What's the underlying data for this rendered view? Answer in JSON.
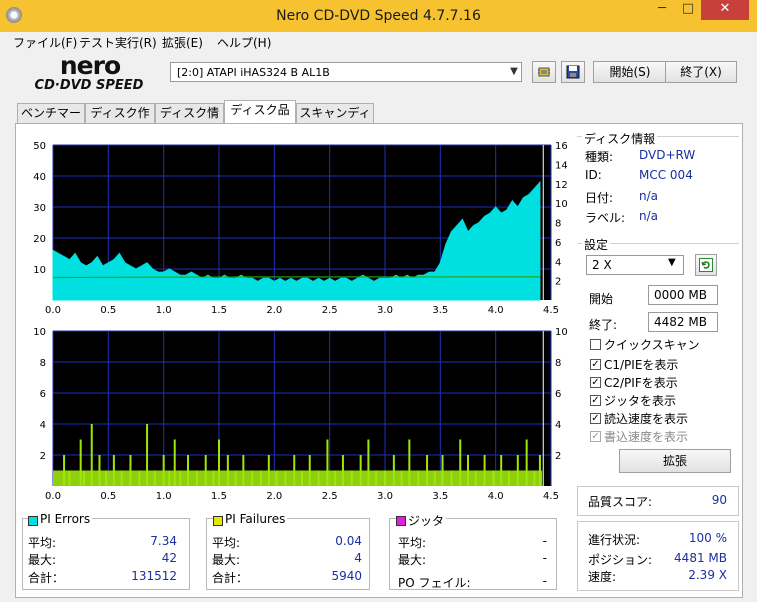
{
  "window": {
    "title": "Nero CD-DVD Speed 4.7.7.16",
    "minimize": "─",
    "maximize": "□",
    "close": "✕"
  },
  "menu": [
    "ファイル(F)",
    "テスト実行(R)",
    "拡張(E)",
    "ヘルプ(H)"
  ],
  "logo": {
    "top": "nero",
    "bottom": "CD·DVD SPEED"
  },
  "toolbar": {
    "drive": "[2:0]   ATAPI iHAS324   B AL1B",
    "start_label": "開始(S)",
    "exit_label": "終了(X)",
    "options_icon": "chip-icon",
    "save_icon": "floppy-disk-icon"
  },
  "tabs": [
    {
      "label": "ベンチマーク"
    },
    {
      "label": "ディスク作成"
    },
    {
      "label": "ディスク情報"
    },
    {
      "label": "ディスク品質",
      "active": true
    },
    {
      "label": "スキャンディスク"
    }
  ],
  "chart_data": [
    {
      "type": "area",
      "title": "PI Errors",
      "x": [
        0.0,
        0.05,
        0.1,
        0.15,
        0.2,
        0.25,
        0.3,
        0.35,
        0.4,
        0.45,
        0.5,
        0.55,
        0.6,
        0.65,
        0.7,
        0.75,
        0.8,
        0.85,
        0.9,
        0.95,
        1.0,
        1.05,
        1.1,
        1.15,
        1.2,
        1.25,
        1.3,
        1.35,
        1.4,
        1.45,
        1.5,
        1.55,
        1.6,
        1.65,
        1.7,
        1.75,
        1.8,
        1.85,
        1.9,
        1.95,
        2.0,
        2.05,
        2.1,
        2.15,
        2.2,
        2.25,
        2.3,
        2.35,
        2.4,
        2.45,
        2.5,
        2.55,
        2.6,
        2.65,
        2.7,
        2.75,
        2.8,
        2.85,
        2.9,
        2.95,
        3.0,
        3.05,
        3.1,
        3.15,
        3.2,
        3.25,
        3.3,
        3.35,
        3.4,
        3.45,
        3.5,
        3.55,
        3.6,
        3.65,
        3.7,
        3.75,
        3.8,
        3.85,
        3.9,
        3.95,
        4.0,
        4.05,
        4.1,
        4.15,
        4.2,
        4.25,
        4.3,
        4.35,
        4.4
      ],
      "series": [
        {
          "name": "PI Errors",
          "values": [
            16,
            15,
            14,
            13,
            15,
            12,
            11,
            12,
            14,
            11,
            12,
            13,
            15,
            12,
            11,
            10,
            11,
            12,
            10,
            9,
            9,
            10,
            9,
            8,
            8,
            9,
            8,
            7,
            8,
            7,
            7,
            8,
            7,
            7,
            8,
            7,
            7,
            6,
            7,
            7,
            6,
            7,
            6,
            7,
            6,
            7,
            7,
            6,
            7,
            6,
            7,
            6,
            7,
            7,
            6,
            7,
            8,
            7,
            6,
            7,
            7,
            7,
            8,
            7,
            8,
            7,
            8,
            8,
            9,
            9,
            12,
            18,
            22,
            24,
            26,
            22,
            24,
            25,
            27,
            28,
            30,
            28,
            29,
            32,
            30,
            33,
            34,
            36,
            38
          ]
        },
        {
          "name": "Read Speed",
          "values": [
            2.32,
            2.32,
            2.32,
            2.33,
            2.33,
            2.33,
            2.33,
            2.34,
            2.34,
            2.34,
            2.34,
            2.34,
            2.34,
            2.35,
            2.35,
            2.35,
            2.35,
            2.35,
            2.36,
            2.36,
            2.36,
            2.36,
            2.36,
            2.36,
            2.37,
            2.37,
            2.37,
            2.37,
            2.37,
            2.37,
            2.37,
            2.37,
            2.37,
            2.38,
            2.38,
            2.38,
            2.38,
            2.38,
            2.38,
            2.38,
            2.38,
            2.38,
            2.38,
            2.38,
            2.38,
            2.38,
            2.38,
            2.38,
            2.38,
            2.38,
            2.38,
            2.38,
            2.38,
            2.38,
            2.38,
            2.38,
            2.38,
            2.38,
            2.38,
            2.38,
            2.38,
            2.38,
            2.38,
            2.38,
            2.38,
            2.38,
            2.38,
            2.38,
            2.38,
            2.38,
            2.38,
            2.38,
            2.39,
            2.39,
            2.39,
            2.39,
            2.39,
            2.39,
            2.39,
            2.39,
            2.39,
            2.39,
            2.39,
            2.39,
            2.39,
            2.39,
            2.39,
            2.39,
            2.39
          ]
        }
      ],
      "yticks_left": [
        "50",
        "40",
        "30",
        "20",
        "10"
      ],
      "yticks_right": [
        "16",
        "14",
        "12",
        "10",
        "8",
        "6",
        "4",
        "2"
      ],
      "xticks": [
        "0.0",
        "0.5",
        "1.0",
        "1.5",
        "2.0",
        "2.5",
        "3.0",
        "3.5",
        "4.0",
        "4.5"
      ],
      "ylim": [
        0,
        50
      ],
      "ylim_right": [
        0,
        16
      ],
      "xlim": [
        0,
        4.5
      ],
      "grid": true,
      "bg": "#000000",
      "color": "#00e0e0",
      "line_color": "#1fa81f"
    },
    {
      "type": "bar",
      "title": "PI Failures",
      "x": [
        0.1,
        0.15,
        0.25,
        0.28,
        0.35,
        0.42,
        0.48,
        0.55,
        0.62,
        0.7,
        0.78,
        0.85,
        0.92,
        1.0,
        1.05,
        1.1,
        1.15,
        1.22,
        1.3,
        1.38,
        1.45,
        1.5,
        1.58,
        1.65,
        1.72,
        1.8,
        1.88,
        1.95,
        2.02,
        2.1,
        2.18,
        2.25,
        2.32,
        2.4,
        2.48,
        2.55,
        2.62,
        2.7,
        2.78,
        2.85,
        2.92,
        3.0,
        3.08,
        3.15,
        3.22,
        3.3,
        3.38,
        3.45,
        3.52,
        3.6,
        3.68,
        3.75,
        3.82,
        3.9,
        3.98,
        4.05,
        4.12,
        4.2,
        4.28,
        4.35,
        4.4
      ],
      "values": [
        2,
        1,
        3,
        1,
        4,
        2,
        1,
        2,
        1,
        2,
        1,
        4,
        1,
        2,
        1,
        3,
        1,
        2,
        1,
        2,
        1,
        3,
        2,
        1,
        2,
        1,
        1,
        2,
        1,
        1,
        2,
        1,
        2,
        1,
        3,
        1,
        2,
        1,
        2,
        3,
        1,
        1,
        2,
        1,
        3,
        1,
        2,
        1,
        2,
        1,
        3,
        2,
        1,
        2,
        1,
        2,
        1,
        2,
        3,
        1,
        2
      ],
      "yticks_left": [
        "10",
        "8",
        "6",
        "4",
        "2"
      ],
      "yticks_right": [
        "10",
        "8",
        "6",
        "4",
        "2"
      ],
      "xticks": [
        "0.0",
        "0.5",
        "1.0",
        "1.5",
        "2.0",
        "2.5",
        "3.0",
        "3.5",
        "4.0",
        "4.5"
      ],
      "ylim": [
        0,
        10
      ],
      "xlim": [
        0,
        4.5
      ],
      "grid": true,
      "bg": "#000000",
      "color": "#9ee60c"
    }
  ],
  "stats": {
    "pi_errors": {
      "title": "PI Errors",
      "color": "#00e0e0",
      "avg_label": "平均:",
      "avg": "7.34",
      "max_label": "最大:",
      "max": "42",
      "total_label": "合計：",
      "total": "131512"
    },
    "pi_failures": {
      "title": "PI Failures",
      "color": "#e6e600",
      "avg_label": "平均:",
      "avg": "0.04",
      "max_label": "最大:",
      "max": "4",
      "total_label": "合計：",
      "total": "5940"
    },
    "jitter": {
      "title": "ジッタ",
      "color": "#e020e0",
      "avg_label": "平均:",
      "avg": "-",
      "max_label": "最大:",
      "max": "-",
      "po_label": "PO フェイル:",
      "po": "-"
    }
  },
  "disc_info": {
    "title": "ディスク情報",
    "type_label": "種類:",
    "type": "DVD+RW",
    "id_label": "ID:",
    "id": "MCC 004",
    "date_label": "日付:",
    "date": "n/a",
    "label_label": "ラベル:",
    "label": "n/a"
  },
  "settings": {
    "title": "設定",
    "speed": "2 X",
    "refresh_icon": "refresh-icon",
    "start_label": "開始",
    "start": "0000 MB",
    "end_label": "終了:",
    "end": "4482 MB",
    "checks": [
      {
        "label": "クイックスキャン",
        "checked": false,
        "disabled": false
      },
      {
        "label": "C1/PIEを表示",
        "checked": true,
        "disabled": false
      },
      {
        "label": "C2/PIFを表示",
        "checked": true,
        "disabled": false
      },
      {
        "label": "ジッタを表示",
        "checked": true,
        "disabled": false
      },
      {
        "label": "読込速度を表示",
        "checked": true,
        "disabled": false
      },
      {
        "label": "書込速度を表示",
        "checked": true,
        "disabled": true
      }
    ],
    "advanced_label": "拡張"
  },
  "quality": {
    "label": "品質スコア:",
    "value": "90"
  },
  "progress": {
    "progress_label": "進行状況:",
    "progress": "100 %",
    "position_label": "ポジション:",
    "position": "4481 MB",
    "speed_label": "速度:",
    "speed": "2.39 X"
  }
}
